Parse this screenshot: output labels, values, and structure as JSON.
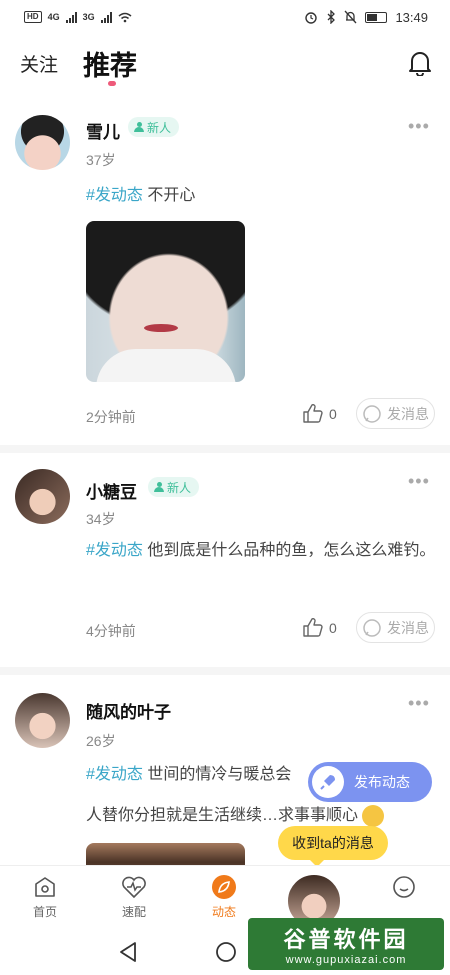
{
  "status_bar": {
    "left": "HD",
    "net1": "4G",
    "net2": "3G",
    "time": "13:49"
  },
  "header": {
    "tab_follow": "关注",
    "tab_recommend": "推荐"
  },
  "posts": [
    {
      "name": "雪儿",
      "badge": "新人",
      "age": "37岁",
      "tag": "#发动态",
      "text": "不开心",
      "time": "2分钟前",
      "likes": "0",
      "msg": "发消息"
    },
    {
      "name": "小糖豆",
      "badge": "新人",
      "age": "34岁",
      "tag": "#发动态",
      "text": "他到底是什么品种的鱼，怎么这么难钓。",
      "time": "4分钟前",
      "likes": "0",
      "msg": "发消息"
    },
    {
      "name": "随风的叶子",
      "age": "26岁",
      "tag": "#发动态",
      "text": "世间的情冷与暖总会",
      "text2": "人替你分担就是生活继续…求事事顺心"
    }
  ],
  "floating": {
    "publish": "发布动态",
    "toast": "收到ta的消息"
  },
  "tabbar": {
    "home": "首页",
    "match": "速配",
    "feed": "动态"
  },
  "watermark": {
    "title": "谷普软件园",
    "url": "www.gupuxiazai.com"
  },
  "colors": {
    "accent": "#f07a1a",
    "tag": "#3aa6c8",
    "badge": "#3fbf9a",
    "publish": "#7c93f0",
    "toast": "#ffd84a"
  }
}
